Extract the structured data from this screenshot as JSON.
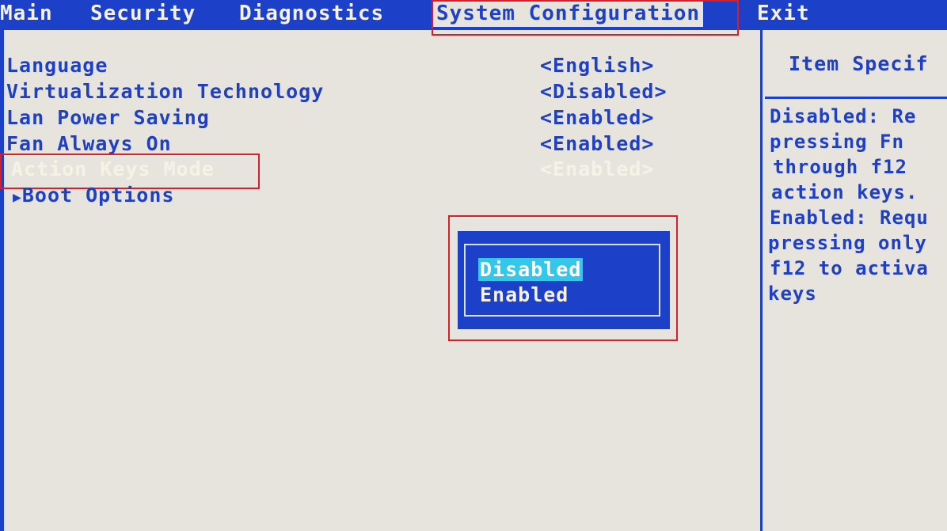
{
  "menu": {
    "items": [
      {
        "label": "Main"
      },
      {
        "label": "Security"
      },
      {
        "label": "Diagnostics"
      },
      {
        "label": "System Configuration"
      },
      {
        "label": "Exit"
      }
    ],
    "active": "System Configuration"
  },
  "settings": [
    {
      "label": "Language",
      "value": "<English>"
    },
    {
      "label": "Virtualization Technology",
      "value": "<Disabled>"
    },
    {
      "label": "Lan Power Saving",
      "value": "<Enabled>"
    },
    {
      "label": "Fan Always On",
      "value": "<Enabled>"
    },
    {
      "label": "Action Keys Mode",
      "value": "<Enabled>"
    },
    {
      "label": "Boot Options",
      "value": ""
    }
  ],
  "help": {
    "title": "Item Specif",
    "lines": [
      "Disabled: Re",
      "pressing Fn",
      "through f12",
      "action keys.",
      "Enabled: Requ",
      "pressing only",
      "f12 to activa",
      "keys"
    ]
  },
  "popup": {
    "options": [
      "Disabled",
      "Enabled"
    ],
    "highlighted": "Disabled"
  },
  "colors": {
    "bios_blue": "#1d40c8",
    "background": "#e6e4dc",
    "highlight_cyan": "#35c7ea",
    "annotation_red": "#d61f2a"
  },
  "icons": {
    "submenu": "triangle-right-icon"
  }
}
